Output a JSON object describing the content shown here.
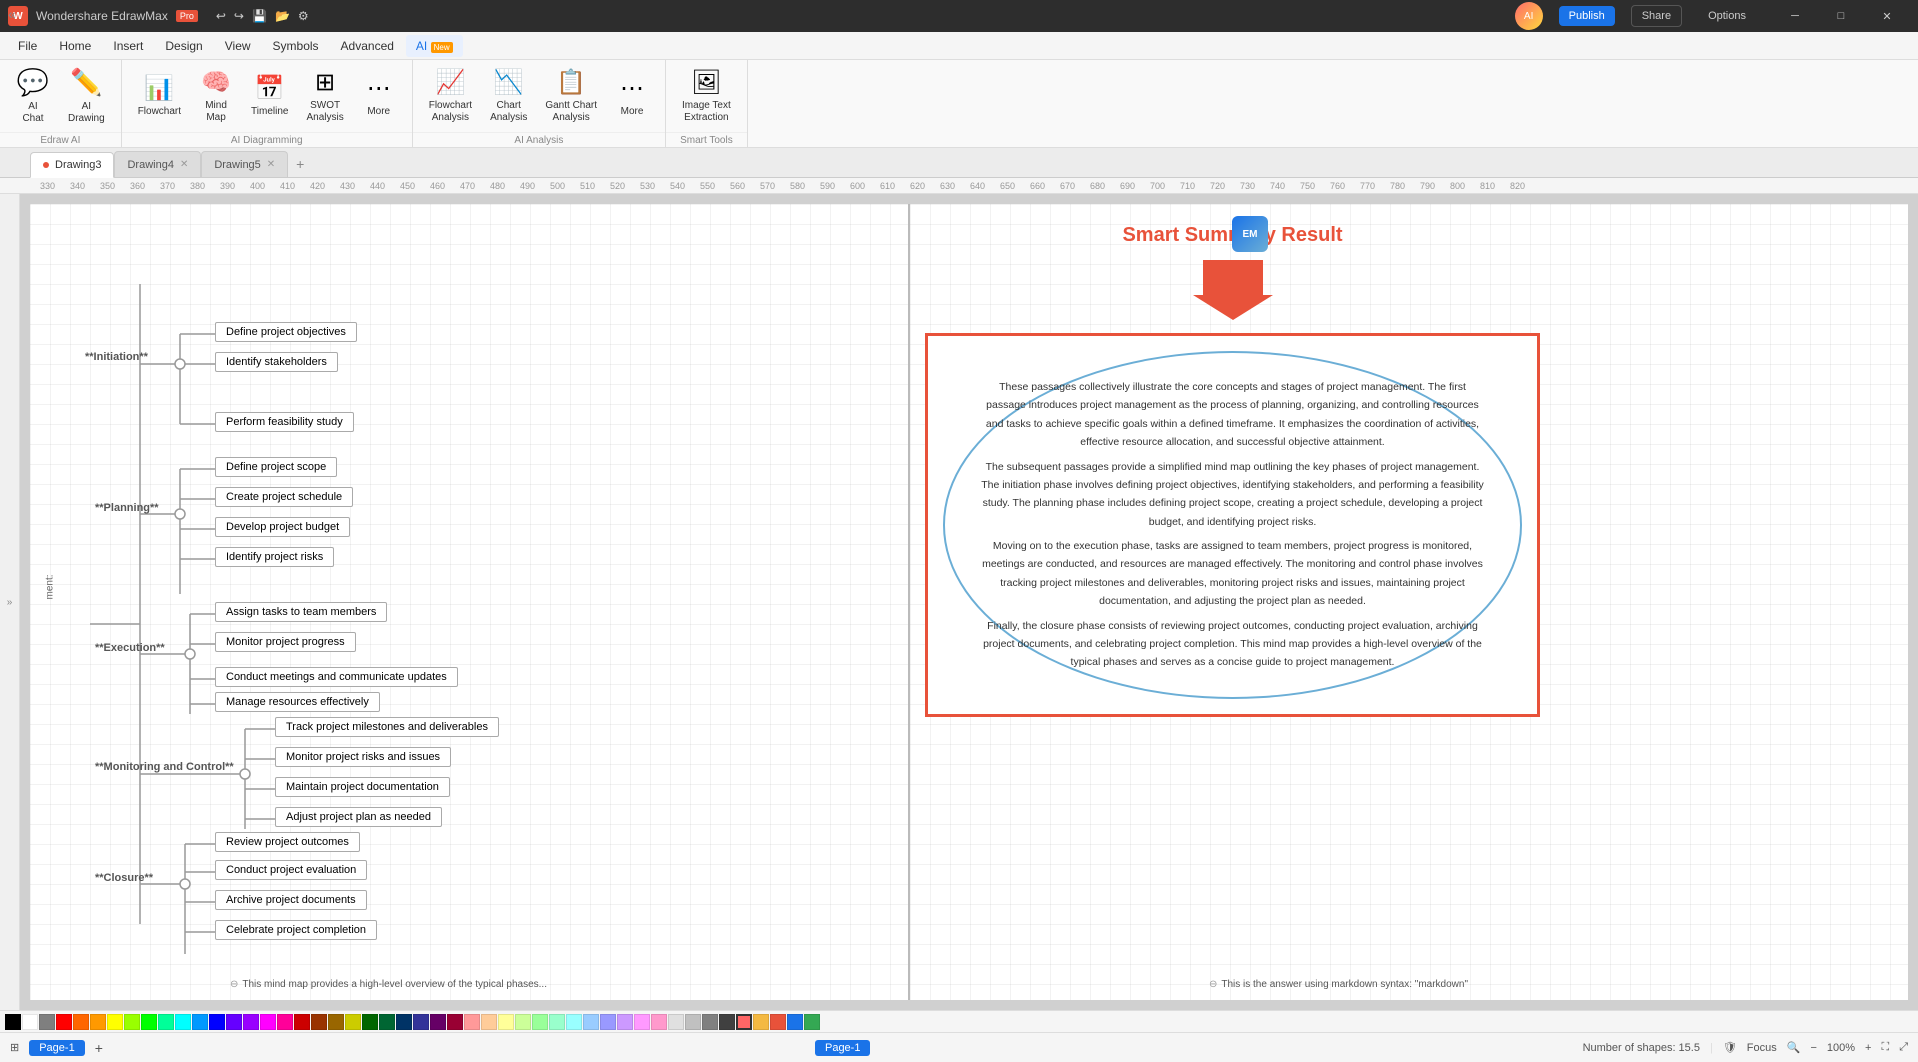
{
  "titleBar": {
    "appName": "Wondershare EdrawMax",
    "badgeText": "Pro",
    "toolbarIcons": [
      "undo",
      "redo",
      "save",
      "open",
      "new"
    ],
    "windowButtons": [
      "minimize",
      "maximize",
      "close"
    ]
  },
  "menuBar": {
    "items": [
      "File",
      "Home",
      "Insert",
      "Design",
      "View",
      "Symbols",
      "Advanced",
      "AI"
    ]
  },
  "ribbon": {
    "groups": [
      {
        "id": "edraw-ai",
        "label": "Edraw AI",
        "items": [
          {
            "id": "ai-chat",
            "icon": "💬",
            "label": "AI\nChat"
          },
          {
            "id": "ai-drawing",
            "icon": "🎨",
            "label": "AI\nDrawing"
          }
        ]
      },
      {
        "id": "ai-diagramming",
        "label": "AI Diagramming",
        "items": [
          {
            "id": "flowchart",
            "icon": "📊",
            "label": "Flowchart"
          },
          {
            "id": "mind-map",
            "icon": "🧠",
            "label": "Mind\nMap"
          },
          {
            "id": "timeline",
            "icon": "📅",
            "label": "Timeline"
          },
          {
            "id": "swot",
            "icon": "⬜",
            "label": "SWOT\nAnalysis"
          },
          {
            "id": "more1",
            "icon": "⋯",
            "label": "More"
          }
        ]
      },
      {
        "id": "ai-analysis",
        "label": "AI Analysis",
        "items": [
          {
            "id": "flowchart-analysis",
            "icon": "📈",
            "label": "Flowchart\nAnalysis"
          },
          {
            "id": "chart-analysis",
            "icon": "📉",
            "label": "Chart\nAnalysis"
          },
          {
            "id": "gantt-analysis",
            "icon": "📋",
            "label": "Gantt Chart\nAnalysis"
          },
          {
            "id": "more2",
            "icon": "⋯",
            "label": "More"
          }
        ]
      },
      {
        "id": "smart-tools",
        "label": "Smart Tools",
        "items": [
          {
            "id": "image-text",
            "icon": "🖼",
            "label": "Image Text\nExtraction"
          }
        ]
      }
    ],
    "aiTabBadge": "New"
  },
  "tabs": [
    {
      "id": "drawing3",
      "label": "Drawing3",
      "active": true,
      "hasIndicator": true
    },
    {
      "id": "drawing4",
      "label": "Drawing4",
      "active": false
    },
    {
      "id": "drawing5",
      "label": "Drawing5",
      "active": false
    }
  ],
  "ruler": {
    "marks": [
      "330",
      "340",
      "350",
      "360",
      "370",
      "380",
      "390",
      "400",
      "410",
      "420",
      "430",
      "440",
      "450",
      "460",
      "470",
      "480",
      "490",
      "500",
      "510",
      "520",
      "530",
      "540",
      "550",
      "560",
      "570",
      "580",
      "590",
      "600",
      "610",
      "620",
      "630",
      "640",
      "650",
      "660",
      "670",
      "680",
      "690",
      "700",
      "710",
      "720",
      "730",
      "740",
      "750",
      "760",
      "770",
      "780",
      "790",
      "800",
      "810",
      "820"
    ]
  },
  "smartSummary": {
    "title": "Smart Summary Result",
    "content": "These passages collectively illustrate the core concepts and stages of project management. The first passage introduces project management as the process of planning, organizing, and controlling resources and tasks to achieve specific goals within a defined timeframe. It emphasizes the coordination of activities, effective resource allocation, and successful objective attainment.\nThe subsequent passages provide a simplified mind map outlining the key phases of project management. The initiation phase involves defining project objectives, identifying stakeholders, and performing a feasibility study. The planning phase includes defining project scope, creating a project schedule, developing a project budget, and identifying project risks.\nMoving on to the execution phase, tasks are assigned to team members, project progress is monitored, meetings are conducted, and resources are managed effectively. The monitoring and control phase involves tracking project milestones and deliverables, monitoring project risks and issues, maintaining project documentation, and adjusting the project plan as needed.\nFinally, the closure phase consists of reviewing project outcomes, conducting project evaluation, archiving project documents, and celebrating project completion. This mind map provides a high-level overview of the typical phases and serves as a concise guide to project management."
  },
  "mindmap": {
    "center": "**Project\nManagement**",
    "phases": [
      {
        "id": "initiation",
        "label": "**Initiation**",
        "nodes": [
          "Define project objectives",
          "Identify stakeholders",
          "Perform feasibility study"
        ]
      },
      {
        "id": "planning",
        "label": "**Planning**",
        "nodes": [
          "Define project scope",
          "Create project schedule",
          "Develop project budget",
          "Identify project risks"
        ]
      },
      {
        "id": "execution",
        "label": "**Execution**",
        "nodes": [
          "Assign tasks to team members",
          "Monitor project progress",
          "Conduct meetings and communicate updates",
          "Manage resources effectively"
        ]
      },
      {
        "id": "monitoring",
        "label": "**Monitoring and Control**",
        "nodes": [
          "Track project milestones and deliverables",
          "Monitor project risks and issues",
          "Maintain project documentation",
          "Adjust project plan as needed"
        ]
      },
      {
        "id": "closure",
        "label": "**Closure**",
        "nodes": [
          "Review project outcomes",
          "Conduct project evaluation",
          "Archive project documents",
          "Celebrate project completion"
        ]
      }
    ]
  },
  "bottomNotes": [
    "This mind map provides a high-level overview of the typical phases...",
    "This is the answer using markdown syntax: \"markdown\""
  ],
  "statusBar": {
    "left": {
      "icons": [
        "layers",
        "page"
      ],
      "pageLabel": "Page-1"
    },
    "pages": [
      "Page-1"
    ],
    "activePage": "Page-1",
    "right": {
      "shapes": "Number of shapes: 15.5",
      "zoom": "100%",
      "zoomLabel": "Focus"
    }
  },
  "header": {
    "publishLabel": "Publish",
    "shareLabel": "Share",
    "optionsLabel": "Options"
  }
}
